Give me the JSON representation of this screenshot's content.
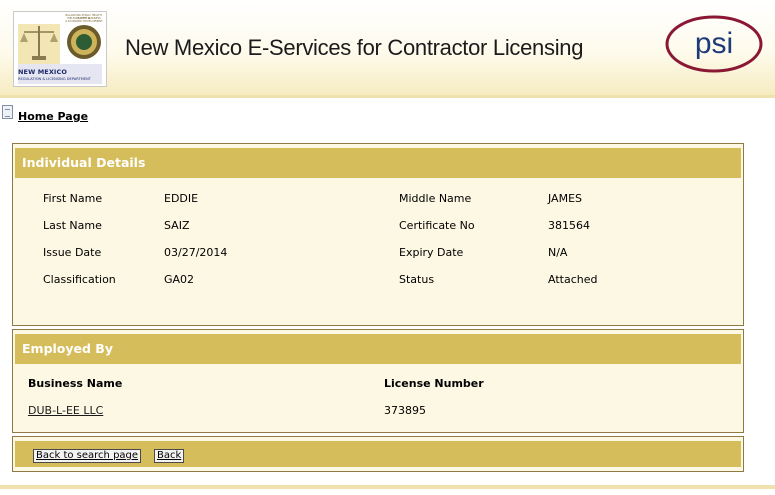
{
  "header": {
    "title": "New Mexico E-Services for Contractor Licensing",
    "logo": {
      "small_text_1": "BALANCING PUBLIC HEALTH, SAFETY &",
      "small_text_2": "WELFARE WITH BUSINESS",
      "small_text_3": "& ECONOMIC DEVELOPMENT",
      "name": "NEW MEXICO",
      "department": "REGULATION & LICENSING DEPARTMENT"
    },
    "brand": "psi",
    "brand_color": "#8a1733"
  },
  "nav": {
    "home": "Home Page"
  },
  "individual": {
    "heading": "Individual Details",
    "first_name_label": "First Name",
    "first_name": "EDDIE",
    "middle_name_label": "Middle Name",
    "middle_name": "JAMES",
    "last_name_label": "Last Name",
    "last_name": "SAIZ",
    "certificate_label": "Certificate No",
    "certificate": "381564",
    "issue_date_label": "Issue Date",
    "issue_date": "03/27/2014",
    "expiry_date_label": "Expiry Date",
    "expiry_date": "N/A",
    "classification_label": "Classification",
    "classification": "GA02",
    "status_label": "Status",
    "status": "Attached"
  },
  "employed": {
    "heading": "Employed By",
    "business_col": "Business Name",
    "license_col": "License Number",
    "rows": [
      {
        "business": "DUB-L-EE LLC",
        "license": "373895"
      }
    ]
  },
  "actions": {
    "back_search": "Back to search page",
    "back": "Back"
  },
  "colors": {
    "panel_header": "#d6bd5b",
    "panel_bg": "#fdf8e3",
    "border": "#8f7a44"
  }
}
